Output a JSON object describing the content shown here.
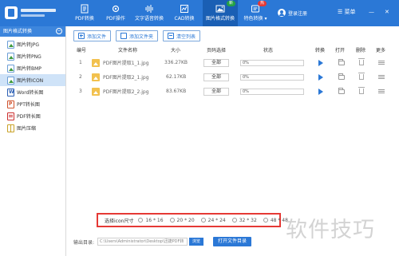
{
  "toolbar": {
    "items": [
      {
        "label": "PDF转换",
        "icon": "pdf-convert-icon"
      },
      {
        "label": "PDF操作",
        "icon": "gear-icon"
      },
      {
        "label": "文字语音转换",
        "icon": "audio-wave-icon"
      },
      {
        "label": "CAD转换",
        "icon": "cad-icon"
      },
      {
        "label": "图片格式转换",
        "icon": "image-icon",
        "badge": "新",
        "active": true
      },
      {
        "label": "特色转换",
        "icon": "feature-icon",
        "badge": "热"
      }
    ],
    "login": "登录注册",
    "menu": "菜单",
    "colors": {
      "bar": "#2b78d6",
      "active": "#1a5fb4"
    }
  },
  "sidebar": {
    "header": "图片格式转换",
    "toggle": "−",
    "items": [
      {
        "label": "图片转JPG",
        "icon": "image-file-icon"
      },
      {
        "label": "图片转PNG",
        "icon": "image-file-icon"
      },
      {
        "label": "图片转BMP",
        "icon": "image-file-icon"
      },
      {
        "label": "图片转ICON",
        "icon": "image-file-icon",
        "active": true
      },
      {
        "label": "Word转长图",
        "icon": "word-file-icon"
      },
      {
        "label": "PPT转长图",
        "icon": "ppt-file-icon"
      },
      {
        "label": "PDF转长图",
        "icon": "pdf-file-icon"
      },
      {
        "label": "图片压缩",
        "icon": "zip-file-icon"
      }
    ]
  },
  "actions": {
    "add_file": "添加文件",
    "add_folder": "添加文件夹",
    "clear_list": "清空列表"
  },
  "table": {
    "headers": [
      "编号",
      "文件名称",
      "大小",
      "页码选择",
      "状态",
      "转换",
      "打开",
      "删除",
      "更多"
    ],
    "rows": [
      {
        "index": "1",
        "name": "PDF图片提取1_1.jpg",
        "size": "336.27KB",
        "pages": "全部",
        "status": "0%"
      },
      {
        "index": "2",
        "name": "PDF图片提取2_1.jpg",
        "size": "62.17KB",
        "pages": "全部",
        "status": "0%"
      },
      {
        "index": "3",
        "name": "PDF图片提取2_2.jpg",
        "size": "83.67KB",
        "pages": "全部",
        "status": "0%"
      }
    ]
  },
  "icon_size": {
    "label": "选择icon尺寸",
    "options": [
      "16 * 16",
      "20 * 20",
      "24 * 24",
      "32 * 32",
      "48 * 48"
    ]
  },
  "output": {
    "label": "输出目录:",
    "path": "C:\\Users\\Administrator\\Desktop\\迅捷PDF转",
    "browse": "浏览",
    "open_folder": "打开文件目录"
  },
  "watermark": "软件技巧"
}
